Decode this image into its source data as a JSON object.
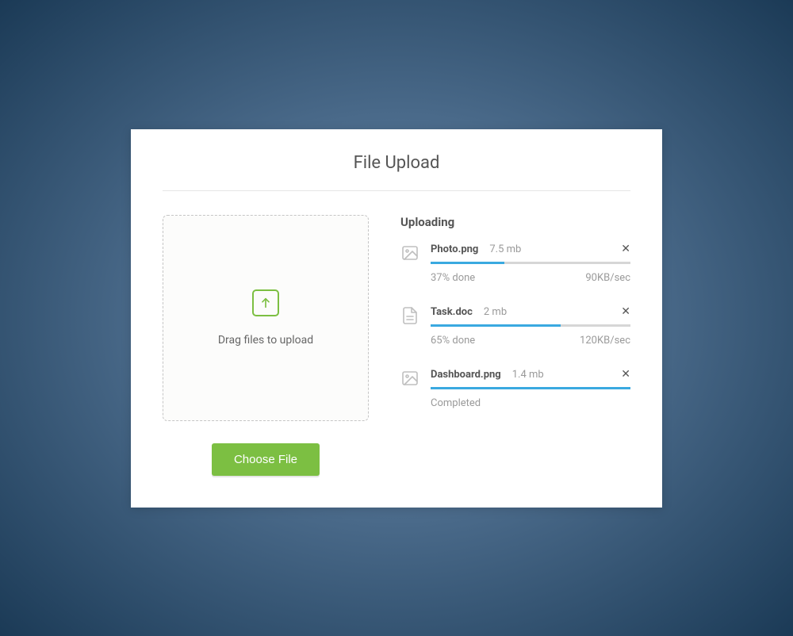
{
  "title": "File Upload",
  "dropzone": {
    "text": "Drag files to upload",
    "button": "Choose File"
  },
  "uploading": {
    "heading": "Uploading",
    "files": [
      {
        "icon": "image",
        "name": "Photo.png",
        "size": "7.5 mb",
        "progress": 37,
        "status_left": "37% done",
        "status_right": "90KB/sec"
      },
      {
        "icon": "document",
        "name": "Task.doc",
        "size": "2 mb",
        "progress": 65,
        "status_left": "65% done",
        "status_right": "120KB/sec"
      },
      {
        "icon": "image",
        "name": "Dashboard.png",
        "size": "1.4 mb",
        "progress": 100,
        "status_left": "Completed",
        "status_right": ""
      }
    ]
  },
  "colors": {
    "accent_green": "#7cbf42",
    "progress_blue": "#3aa9e0"
  }
}
